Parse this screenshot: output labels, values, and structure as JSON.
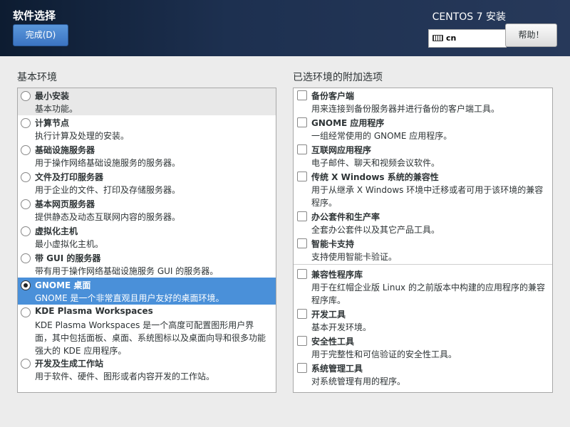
{
  "header": {
    "title": "软件选择",
    "done_label": "完成(D)",
    "product": "CENTOS 7 安装",
    "keyboard_layout": "cn",
    "help_label": "帮助！"
  },
  "base_env": {
    "title": "基本环境",
    "selected": "GNOME 桌面",
    "items": [
      {
        "title": "最小安装",
        "desc": "基本功能。"
      },
      {
        "title": "计算节点",
        "desc": "执行计算及处理的安装。"
      },
      {
        "title": "基础设施服务器",
        "desc": "用于操作网络基础设施服务的服务器。"
      },
      {
        "title": "文件及打印服务器",
        "desc": "用于企业的文件、打印及存储服务器。"
      },
      {
        "title": "基本网页服务器",
        "desc": "提供静态及动态互联网内容的服务器。"
      },
      {
        "title": "虚拟化主机",
        "desc": "最小虚拟化主机。"
      },
      {
        "title": "带 GUI 的服务器",
        "desc": "带有用于操作网络基础设施服务 GUI 的服务器。"
      },
      {
        "title": "GNOME 桌面",
        "desc": "GNOME 是一个非常直观且用户友好的桌面环境。"
      },
      {
        "title": "KDE Plasma Workspaces",
        "desc": "KDE Plasma Workspaces 是一个高度可配置图形用户界面，其中包括面板、桌面、系统图标以及桌面向导和很多功能强大的 KDE 应用程序。"
      },
      {
        "title": "开发及生成工作站",
        "desc": "用于软件、硬件、图形或者内容开发的工作站。"
      }
    ]
  },
  "addons": {
    "title": "已选环境的附加选项",
    "items": [
      {
        "title": "备份客户端",
        "desc": "用来连接到备份服务器并进行备份的客户端工具。",
        "checked": false
      },
      {
        "title": "GNOME 应用程序",
        "desc": "一组经常使用的 GNOME 应用程序。",
        "checked": false
      },
      {
        "title": "互联网应用程序",
        "desc": "电子邮件、聊天和视频会议软件。",
        "checked": false
      },
      {
        "title": "传统 X Windows 系统的兼容性",
        "desc": "用于从继承 X Windows 环境中迁移或者可用于该环境的兼容程序。",
        "checked": false
      },
      {
        "title": "办公套件和生产率",
        "desc": "全套办公套件以及其它产品工具。",
        "checked": false
      },
      {
        "title": "智能卡支持",
        "desc": "支持使用智能卡验证。",
        "checked": false
      },
      {
        "title": "兼容性程序库",
        "desc": "用于在红帽企业版 Linux 的之前版本中构建的应用程序的兼容程序库。",
        "checked": false
      },
      {
        "title": "开发工具",
        "desc": "基本开发环境。",
        "checked": false
      },
      {
        "title": "安全性工具",
        "desc": "用于完整性和可信验证的安全性工具。",
        "checked": false
      },
      {
        "title": "系统管理工具",
        "desc": "对系统管理有用的程序。",
        "checked": false
      }
    ]
  }
}
